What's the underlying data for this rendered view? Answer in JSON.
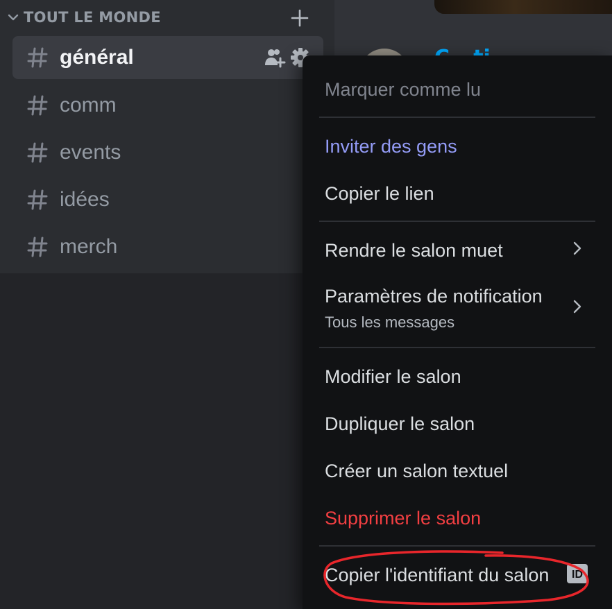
{
  "category": {
    "label": "TOUT LE MONDE",
    "chevron_icon": "chevron-down-icon",
    "add_icon": "plus-icon"
  },
  "channels": [
    {
      "name": "général",
      "active": true
    },
    {
      "name": "comm",
      "active": false
    },
    {
      "name": "events",
      "active": false
    },
    {
      "name": "idées",
      "active": false
    },
    {
      "name": "merch",
      "active": false
    }
  ],
  "channel_actions": {
    "invite_icon": "add-member-icon",
    "settings_icon": "gear-icon"
  },
  "chat": {
    "visible_name": "C...ti..."
  },
  "context_menu": {
    "mark_read": "Marquer comme lu",
    "invite": "Inviter des gens",
    "copy_link": "Copier le lien",
    "mute": "Rendre le salon muet",
    "notification_settings": "Paramètres de notification",
    "notification_value": "Tous les messages",
    "edit_channel": "Modifier le salon",
    "duplicate_channel": "Dupliquer le salon",
    "create_text_channel": "Créer un salon textuel",
    "delete_channel": "Supprimer le salon",
    "copy_channel_id": "Copier l'identifiant du salon",
    "id_badge": "ID"
  },
  "colors": {
    "sidebar_bg": "#2b2d31",
    "menu_bg": "#111214",
    "blurple": "#949cf7",
    "danger": "#f23f42",
    "annotation_red": "#e8262b"
  }
}
